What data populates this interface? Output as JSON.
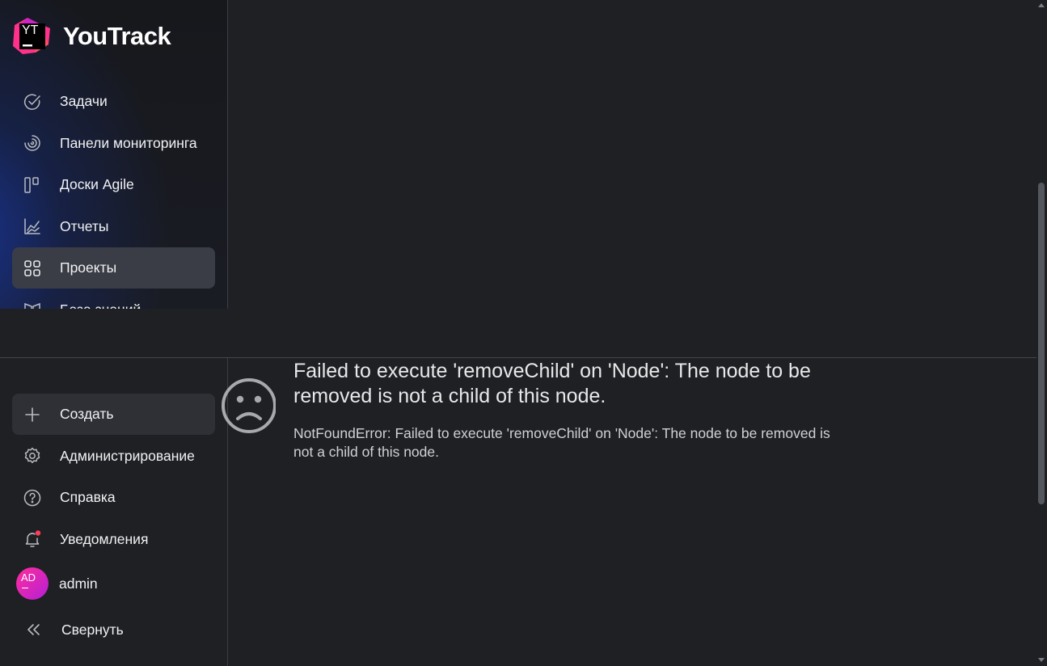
{
  "app": {
    "logo_mark_text": "YT",
    "title": "YouTrack"
  },
  "sidebar": {
    "items": [
      {
        "label": "Задачи",
        "icon": "check-circle-icon"
      },
      {
        "label": "Панели мониторинга",
        "icon": "dashboard-icon"
      },
      {
        "label": "Доски Agile",
        "icon": "agile-board-icon"
      },
      {
        "label": "Отчеты",
        "icon": "reports-chart-icon"
      },
      {
        "label": "Проекты",
        "icon": "projects-grid-icon",
        "active": true
      },
      {
        "label": "База знаний",
        "icon": "knowledge-base-icon"
      }
    ],
    "bottom_items": [
      {
        "label": "Создать",
        "icon": "plus-icon"
      },
      {
        "label": "Администрирование",
        "icon": "gear-icon"
      },
      {
        "label": "Справка",
        "icon": "help-icon"
      },
      {
        "label": "Уведомления",
        "icon": "bell-icon",
        "has_unread": true
      }
    ],
    "user": {
      "initials": "AD",
      "name": "admin"
    },
    "collapse_label": "Свернуть"
  },
  "error": {
    "title": "Failed to execute 'removeChild' on 'Node': The node to be removed is not a child of this node.",
    "detail": "NotFoundError: Failed to execute 'removeChild' on 'Node': The node to be removed is not a child of this node."
  },
  "colors": {
    "background": "#1f2023",
    "active_item": "#3a3d45",
    "brand_pink": "#ff318c",
    "notification_dot": "#ff3b5c"
  }
}
